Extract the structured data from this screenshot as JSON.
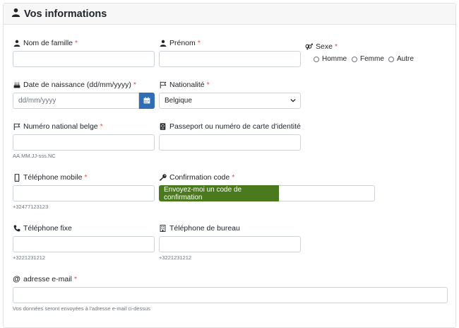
{
  "panel": {
    "title": "Vos informations"
  },
  "fields": {
    "lastname": {
      "label": "Nom de famille",
      "required": "*"
    },
    "firstname": {
      "label": "Prénom",
      "required": "*"
    },
    "sex": {
      "label": "Sexe",
      "required": "*",
      "options": [
        "Homme",
        "Femme",
        "Autre"
      ]
    },
    "birthdate": {
      "label": "Date de naissance (dd/mm/yyyy)",
      "required": "*",
      "placeholder": "dd/mm/yyyy"
    },
    "nationality": {
      "label": "Nationalité",
      "required": "*",
      "selected": "Belgique"
    },
    "national_number": {
      "label": "Numéro national belge",
      "required": "*",
      "help": "AA.MM.JJ-sss.NC"
    },
    "passport": {
      "label": "Passeport ou numéro de carte d'identité"
    },
    "mobile": {
      "label": "Téléphone mobile",
      "required": "*",
      "help": "+32477123123"
    },
    "confirmation": {
      "label": "Confirmation code",
      "required": "*",
      "button": "Envoyez-moi un code de confirmation"
    },
    "landline": {
      "label": "Téléphone fixe",
      "help": "+3221231212"
    },
    "office": {
      "label": "Téléphone de bureau",
      "help": "+3221231212"
    },
    "email": {
      "label": "adresse e-mail",
      "required": "*",
      "help": "Vos données seront envoyées à l'adresse e-mail ci-dessus"
    }
  },
  "colors": {
    "required": "#d9534f",
    "calendar_button": "#2f6db5",
    "confirm_button": "#4b7a1e"
  },
  "icons": {
    "title": "user-icon",
    "lastname": "user-icon",
    "firstname": "user-icon",
    "sex": "gender-icon",
    "birthdate": "birthday-cake-icon",
    "nationality": "flag-icon",
    "national_number": "flag-icon",
    "passport": "passport-icon",
    "mobile": "mobile-phone-icon",
    "confirmation": "key-icon",
    "landline": "phone-icon",
    "office": "building-icon",
    "email": "at-icon",
    "calendar": "calendar-icon",
    "select": "chevron-down-icon"
  }
}
